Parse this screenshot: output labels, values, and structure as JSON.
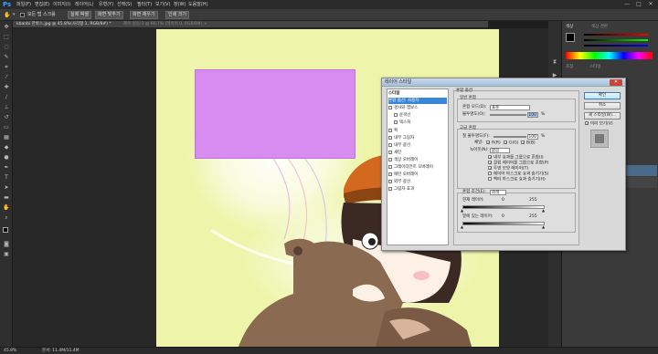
{
  "app": {
    "logo": "Ps"
  },
  "menubar": {
    "items": [
      "파일(F)",
      "편집(E)",
      "이미지(I)",
      "레이어(L)",
      "유형(Y)",
      "선택(S)",
      "필터(T)",
      "보기(V)",
      "창(W)",
      "도움말(H)"
    ]
  },
  "window_controls": {
    "minimize": "—",
    "maximize": "□",
    "close": "✕"
  },
  "optionsbar": {
    "option1": "모든 탭 스크롤",
    "option2": "실제 픽셀",
    "option3": "화면 맞추기",
    "option4": "화면 채우기",
    "option5": "인쇄 크기"
  },
  "document": {
    "tab_label": "kbanbi 한바스.jpg @ 45.8%(사각형 1, RGB/8#) *",
    "other_tab_label": "제목 없음-1 @ 66.7% (레이어 0, RGB/8#) ×"
  },
  "statusbar": {
    "zoom": "45.8%",
    "doc_info": "문서: 11.4M/11.4M"
  },
  "right_panels": {
    "color_tab": "색상",
    "swatches_tab": "색상 견본",
    "layers_tab": "레이어",
    "channels_tab": "채널",
    "adjust_tab": "조정",
    "styles_tab": "스타일",
    "blend_mode": "표준",
    "opacity_label": "불투명도:",
    "fill_label": "칠:",
    "lock_label": "잠그기:"
  },
  "dialog": {
    "title": "레이어 스타일",
    "close": "✕",
    "list": {
      "header": "스타일",
      "items": [
        {
          "label": "혼합 옵션: 사용자",
          "checkbox": false,
          "selected": true
        },
        {
          "label": "경사와 엠보스",
          "checkbox": true,
          "selected": false
        },
        {
          "label": "윤곽선",
          "checkbox": true,
          "selected": false
        },
        {
          "label": "텍스처",
          "checkbox": true,
          "selected": false
        },
        {
          "label": "획",
          "checkbox": true,
          "selected": false
        },
        {
          "label": "내부 그림자",
          "checkbox": true,
          "selected": false
        },
        {
          "label": "내부 광선",
          "checkbox": true,
          "selected": false
        },
        {
          "label": "새틴",
          "checkbox": true,
          "selected": false
        },
        {
          "label": "색상 오버레이",
          "checkbox": true,
          "selected": false
        },
        {
          "label": "그레이디언트 오버레이",
          "checkbox": true,
          "selected": false
        },
        {
          "label": "패턴 오버레이",
          "checkbox": true,
          "selected": false
        },
        {
          "label": "외부 광선",
          "checkbox": true,
          "selected": false
        },
        {
          "label": "그림자 효과",
          "checkbox": true,
          "selected": false
        }
      ]
    },
    "blending": {
      "group_title": "혼합 옵션",
      "general_title": "일반 혼합",
      "blend_mode_label": "혼합 모드(D):",
      "blend_mode_value": "표준",
      "opacity_label": "불투명도(O):",
      "opacity_value": "100",
      "percent": "%",
      "advanced_title": "고급 혼합",
      "fill_opacity_label": "칠 불투명도(F):",
      "fill_opacity_value": "100",
      "channels_label": "채널:",
      "channel_r": "R(R)",
      "channel_g": "G(G)",
      "channel_b": "B(B)",
      "knockout_label": "녹아웃(N):",
      "knockout_value": "없음",
      "options": [
        "내부 효과를 그룹으로 혼합(I)",
        "클립 레이어를 그룹으로 혼합(P)",
        "투명 모양 레이어(T)",
        "레이어 마스크로 효과 숨기기(S)",
        "벡터 마스크로 효과 숨기기(H)"
      ],
      "blend_if_label": "혼합 조건(E):",
      "blend_if_value": "회색",
      "this_layer_label": "현재 레이어:",
      "this_layer_min": "0",
      "this_layer_max": "255",
      "underlying_label": "밑에 있는 레이어:",
      "underlying_min": "0",
      "underlying_max": "255"
    },
    "buttons": {
      "ok": "확인",
      "cancel": "취소",
      "new_style": "새 스타일(W)...",
      "preview": "미리 보기(V)"
    }
  },
  "colors": {
    "canvas_bg": "#eef5ab",
    "selection_rect": "#d88cf0",
    "dialog_bg": "#d9d9d9",
    "list_selection": "#3a86d6"
  }
}
